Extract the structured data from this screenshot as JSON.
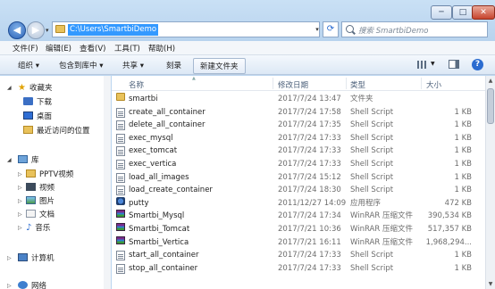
{
  "address": {
    "path": "C:\\Users\\SmartbiDemo",
    "search_placeholder": "搜索 SmartbiDemo"
  },
  "window_controls": {
    "min": "─",
    "max": "□",
    "close": "✕"
  },
  "menu": [
    "文件(F)",
    "编辑(E)",
    "查看(V)",
    "工具(T)",
    "帮助(H)"
  ],
  "toolbar": {
    "organize": "组织 ▾",
    "include_library": "包含到库中 ▾",
    "share": "共享 ▾",
    "burn": "刻录",
    "new_folder": "新建文件夹",
    "help": "?"
  },
  "nav": {
    "favorites": "收藏夹",
    "downloads": "下载",
    "desktop": "桌面",
    "recent": "最近访问的位置",
    "libraries": "库",
    "pptv": "PPTV视频",
    "videos": "视频",
    "pictures": "图片",
    "documents": "文档",
    "music": "音乐",
    "computer": "计算机",
    "network": "网络"
  },
  "columns": {
    "name": "名称",
    "date": "修改日期",
    "type": "类型",
    "size": "大小"
  },
  "files": [
    {
      "name": "smartbi",
      "date": "2017/7/24 13:47",
      "type": "文件夹",
      "size": "",
      "icon": "folder-icon"
    },
    {
      "name": "create_all_container",
      "date": "2017/7/24 17:58",
      "type": "Shell Script",
      "size": "1 KB",
      "icon": "script-icon"
    },
    {
      "name": "delete_all_container",
      "date": "2017/7/24 17:35",
      "type": "Shell Script",
      "size": "1 KB",
      "icon": "script-icon"
    },
    {
      "name": "exec_mysql",
      "date": "2017/7/24 17:33",
      "type": "Shell Script",
      "size": "1 KB",
      "icon": "script-icon"
    },
    {
      "name": "exec_tomcat",
      "date": "2017/7/24 17:33",
      "type": "Shell Script",
      "size": "1 KB",
      "icon": "script-icon"
    },
    {
      "name": "exec_vertica",
      "date": "2017/7/24 17:33",
      "type": "Shell Script",
      "size": "1 KB",
      "icon": "script-icon"
    },
    {
      "name": "load_all_images",
      "date": "2017/7/24 15:12",
      "type": "Shell Script",
      "size": "1 KB",
      "icon": "script-icon"
    },
    {
      "name": "load_create_container",
      "date": "2017/7/24 18:30",
      "type": "Shell Script",
      "size": "1 KB",
      "icon": "script-icon"
    },
    {
      "name": "putty",
      "date": "2011/12/27 14:09",
      "type": "应用程序",
      "size": "472 KB",
      "icon": "app-icon"
    },
    {
      "name": "Smartbi_Mysql",
      "date": "2017/7/24 17:34",
      "type": "WinRAR 压缩文件",
      "size": "390,534 KB",
      "icon": "rar-icon"
    },
    {
      "name": "Smartbi_Tomcat",
      "date": "2017/7/21 10:36",
      "type": "WinRAR 压缩文件",
      "size": "517,357 KB",
      "icon": "rar-icon"
    },
    {
      "name": "Smartbi_Vertica",
      "date": "2017/7/21 16:11",
      "type": "WinRAR 压缩文件",
      "size": "1,968,294...",
      "icon": "rar-icon"
    },
    {
      "name": "start_all_container",
      "date": "2017/7/24 17:33",
      "type": "Shell Script",
      "size": "1 KB",
      "icon": "script-icon"
    },
    {
      "name": "stop_all_container",
      "date": "2017/7/24 17:33",
      "type": "Shell Script",
      "size": "1 KB",
      "icon": "script-icon"
    }
  ]
}
